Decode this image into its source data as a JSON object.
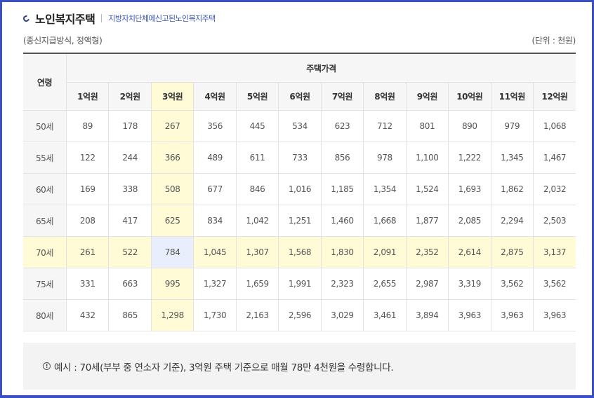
{
  "header": {
    "title": "노인복지주택",
    "subtitle": "지방자치단체에신고된노인복지주택"
  },
  "meta": {
    "left": "(종신지급방식, 정액형)",
    "right": "(단위 : 천원)"
  },
  "table": {
    "age_header": "연령",
    "group_header": "주택가격",
    "columns": [
      "1억원",
      "2억원",
      "3억원",
      "4억원",
      "5억원",
      "6억원",
      "7억원",
      "8억원",
      "9억원",
      "10억원",
      "11억원",
      "12억원"
    ],
    "rows": [
      {
        "age": "50세",
        "values": [
          "89",
          "178",
          "267",
          "356",
          "445",
          "534",
          "623",
          "712",
          "801",
          "890",
          "979",
          "1,068"
        ]
      },
      {
        "age": "55세",
        "values": [
          "122",
          "244",
          "366",
          "489",
          "611",
          "733",
          "856",
          "978",
          "1,100",
          "1,222",
          "1,345",
          "1,467"
        ]
      },
      {
        "age": "60세",
        "values": [
          "169",
          "338",
          "508",
          "677",
          "846",
          "1,016",
          "1,185",
          "1,354",
          "1,524",
          "1,693",
          "1,862",
          "2,032"
        ]
      },
      {
        "age": "65세",
        "values": [
          "208",
          "417",
          "625",
          "834",
          "1,042",
          "1,251",
          "1,460",
          "1,668",
          "1,877",
          "2,085",
          "2,294",
          "2,503"
        ]
      },
      {
        "age": "70세",
        "values": [
          "261",
          "522",
          "784",
          "1,045",
          "1,307",
          "1,568",
          "1,830",
          "2,091",
          "2,352",
          "2,614",
          "2,875",
          "3,137"
        ]
      },
      {
        "age": "75세",
        "values": [
          "331",
          "663",
          "995",
          "1,327",
          "1,659",
          "1,991",
          "2,323",
          "2,655",
          "2,987",
          "3,319",
          "3,562",
          "3,562"
        ]
      },
      {
        "age": "80세",
        "values": [
          "432",
          "865",
          "1,298",
          "1,730",
          "2,163",
          "2,596",
          "3,029",
          "3,461",
          "3,894",
          "3,963",
          "3,963",
          "3,963"
        ]
      }
    ],
    "highlight_column": "3억원",
    "highlight_row": "70세"
  },
  "note": {
    "icon": "info-circle-icon",
    "text": "예시 : 70세(부부 중 연소자 기준), 3억원 주택 기준으로 매월 78만 4천원을 수령합니다."
  },
  "colors": {
    "frame": "#3a4fc4",
    "highlight_yellow": "#fffbd6",
    "highlight_blue": "#e8eefb"
  }
}
